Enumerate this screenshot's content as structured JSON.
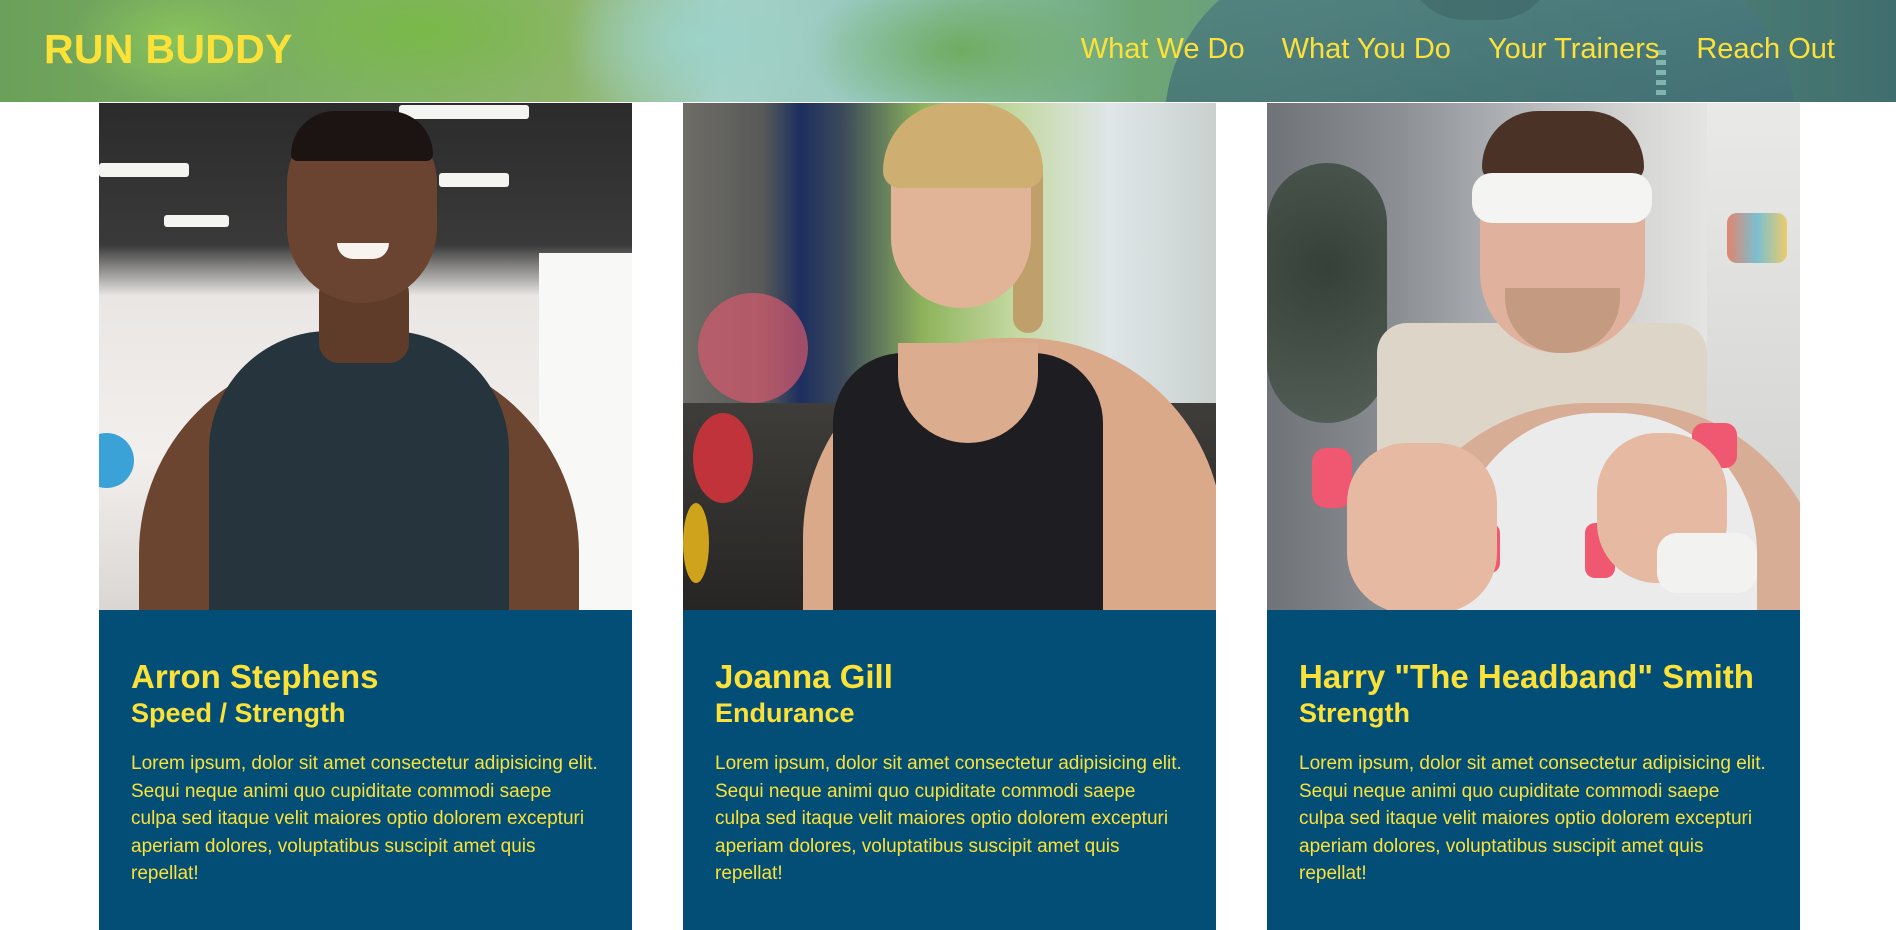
{
  "header": {
    "logo": "RUN BUDDY",
    "nav": [
      "What We Do",
      "What You Do",
      "Your Trainers",
      "Reach Out"
    ]
  },
  "trainers": [
    {
      "name": "Arron Stephens",
      "role": "Speed / Strength",
      "bio": "Lorem ipsum, dolor sit amet consectetur adipisicing elit. Sequi neque animi quo cupiditate commodi saepe culpa sed itaque velit maiores optio dolorem excepturi aperiam dolores, voluptatibus suscipit amet quis repellat!"
    },
    {
      "name": "Joanna Gill",
      "role": "Endurance",
      "bio": "Lorem ipsum, dolor sit amet consectetur adipisicing elit. Sequi neque animi quo cupiditate commodi saepe culpa sed itaque velit maiores optio dolorem excepturi aperiam dolores, voluptatibus suscipit amet quis repellat!"
    },
    {
      "name": "Harry \"The Headband\" Smith",
      "role": "Strength",
      "bio": "Lorem ipsum, dolor sit amet consectetur adipisicing elit. Sequi neque animi quo cupiditate commodi saepe culpa sed itaque velit maiores optio dolorem excepturi aperiam dolores, voluptatibus suscipit amet quis repellat!"
    }
  ],
  "colors": {
    "accent": "#fce138",
    "card_background": "#024e76",
    "page_background": "#ffffff"
  }
}
